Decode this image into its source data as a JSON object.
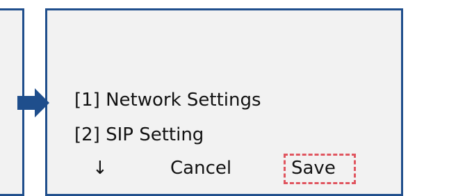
{
  "menu": {
    "items": [
      {
        "label": "[1] Network Settings"
      },
      {
        "label": "[2] SIP Setting"
      }
    ],
    "softkeys": {
      "down_icon": "↓",
      "cancel_label": "Cancel",
      "save_label": "Save"
    }
  },
  "colors": {
    "panel_border": "#1f4e8c",
    "panel_fill": "#f2f2f2",
    "arrow": "#1f4e8c",
    "highlight": "#e0555f"
  },
  "icons": {
    "transition": "right-arrow-icon",
    "scroll": "down-arrow-icon"
  }
}
